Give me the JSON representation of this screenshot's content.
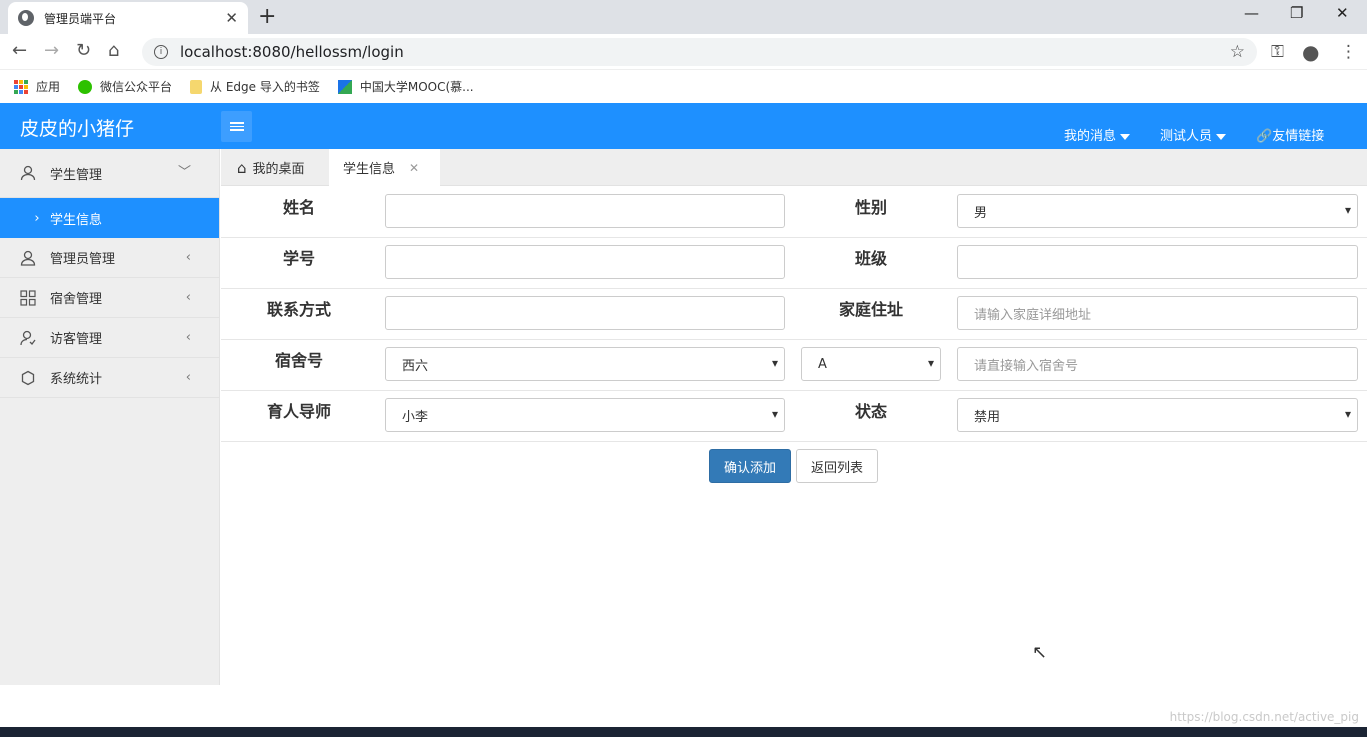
{
  "browser": {
    "tab_title": "管理员端平台",
    "url": "localhost:8080/hellossm/login",
    "bookmarks": [
      "应用",
      "微信公众平台",
      "从 Edge 导入的书签",
      "中国大学MOOC(慕..."
    ]
  },
  "app": {
    "logo": "皮皮的小猪仔",
    "header_nav": [
      "我的消息",
      "测试人员",
      "友情链接"
    ]
  },
  "sidebar": {
    "items": [
      {
        "label": "学生管理",
        "icon": "user-icon"
      },
      {
        "label": "学生信息",
        "icon": "chevron-right-icon"
      },
      {
        "label": "管理员管理",
        "icon": "admin-icon"
      },
      {
        "label": "宿舍管理",
        "icon": "grid-icon"
      },
      {
        "label": "访客管理",
        "icon": "visitor-icon"
      },
      {
        "label": "系统统计",
        "icon": "stats-icon"
      }
    ]
  },
  "page_tabs": {
    "home": "我的桌面",
    "current": "学生信息"
  },
  "form": {
    "name_label": "姓名",
    "gender_label": "性别",
    "gender_value": "男",
    "student_no_label": "学号",
    "class_label": "班级",
    "contact_label": "联系方式",
    "address_label": "家庭住址",
    "address_placeholder": "请输入家庭详细地址",
    "dorm_label": "宿舍号",
    "dorm_building": "西六",
    "dorm_unit": "A",
    "dorm_placeholder": "请直接输入宿舍号",
    "tutor_label": "育人导师",
    "tutor_value": "小李",
    "status_label": "状态",
    "status_value": "禁用"
  },
  "actions": {
    "confirm": "确认添加",
    "back": "返回列表"
  },
  "watermark": "https://blog.csdn.net/active_pig",
  "colors": {
    "brand": "#1e90ff",
    "primary_button": "#337ab7"
  }
}
